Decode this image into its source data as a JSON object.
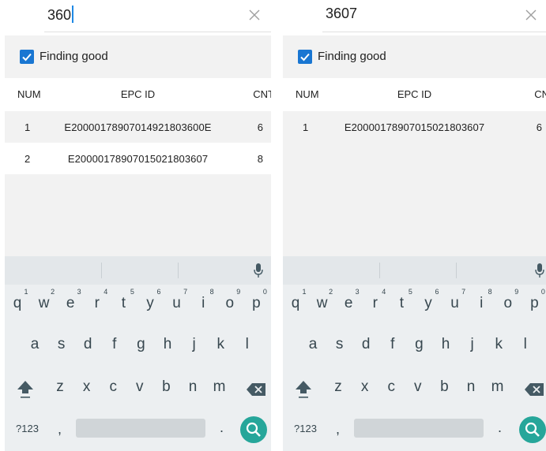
{
  "colors": {
    "accent": "#1976d2",
    "search_key": "#26a69a",
    "keyboard_bg": "#eceff1"
  },
  "left": {
    "search_value": "360",
    "filter_label": "Finding good",
    "headers": {
      "num": "NUM",
      "epc": "EPC ID",
      "cnt": "CNT"
    },
    "rows": [
      {
        "num": "1",
        "epc": "E20000178907014921803600E",
        "cnt": "6"
      },
      {
        "num": "2",
        "epc": "E20000178907015021803607",
        "cnt": "8"
      }
    ]
  },
  "right": {
    "search_value": "3607",
    "filter_label": "Finding good",
    "headers": {
      "num": "NUM",
      "epc": "EPC ID",
      "cnt": "CNT"
    },
    "rows": [
      {
        "num": "1",
        "epc": "E20000178907015021803607",
        "cnt": "6"
      }
    ]
  },
  "keyboard": {
    "row1": [
      "q",
      "w",
      "e",
      "r",
      "t",
      "y",
      "u",
      "i",
      "o",
      "p"
    ],
    "hints": [
      "1",
      "2",
      "3",
      "4",
      "5",
      "6",
      "7",
      "8",
      "9",
      "0"
    ],
    "row2": [
      "a",
      "s",
      "d",
      "f",
      "g",
      "h",
      "j",
      "k",
      "l"
    ],
    "row3": [
      "z",
      "x",
      "c",
      "v",
      "b",
      "n",
      "m"
    ],
    "symbols_key": "?123",
    "comma": ",",
    "period": ".",
    "icons": [
      "mic-icon",
      "shift-icon",
      "backspace-icon",
      "search-icon",
      "close-icon",
      "check-icon"
    ]
  }
}
